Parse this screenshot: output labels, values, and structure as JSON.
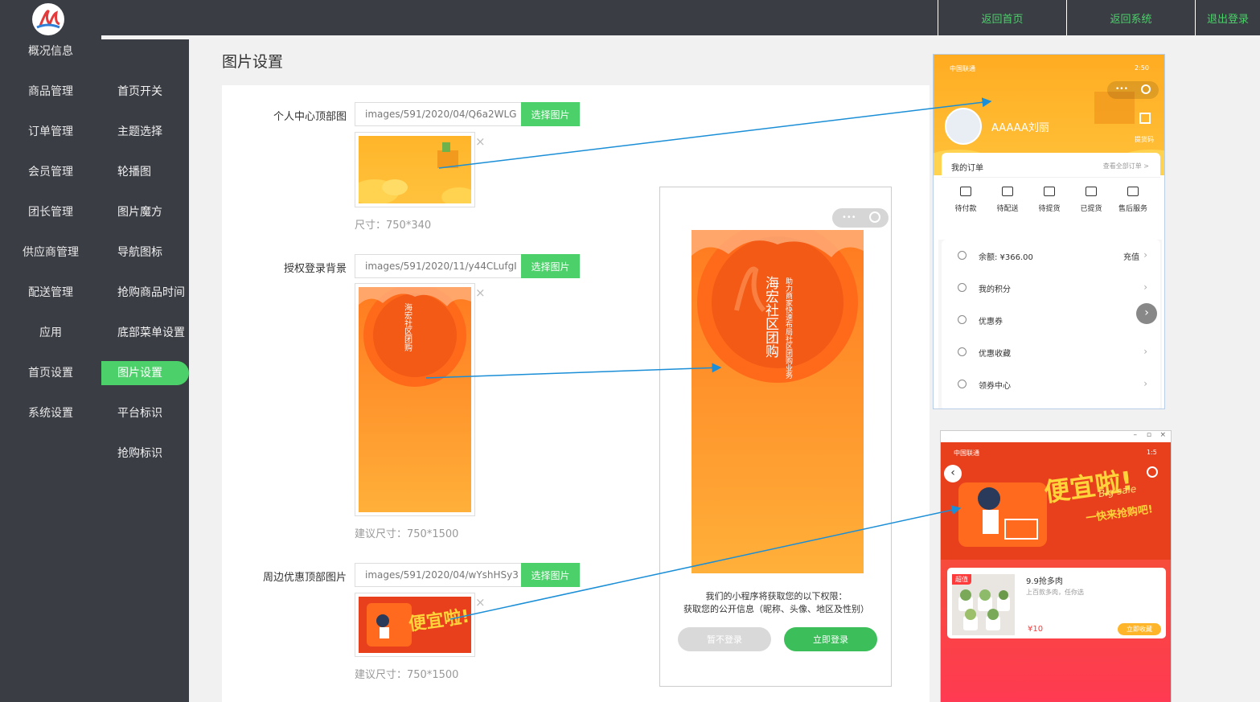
{
  "header": {
    "links": [
      "返回首页",
      "返回系统",
      "退出登录"
    ],
    "accent": "#4cd06a"
  },
  "sidebar_primary": {
    "items": [
      "概况信息",
      "商品管理",
      "订单管理",
      "会员管理",
      "团长管理",
      "供应商管理",
      "配送管理",
      "应用",
      "首页设置",
      "系统设置"
    ]
  },
  "sidebar_secondary": {
    "items": [
      "首页开关",
      "主题选择",
      "轮播图",
      "图片魔方",
      "导航图标",
      "抢购商品时间",
      "底部菜单设置",
      "图片设置",
      "平台标识",
      "抢购标识"
    ],
    "active": "图片设置"
  },
  "page": {
    "title": "图片设置"
  },
  "form": {
    "button_label": "选择图片",
    "fields": [
      {
        "label": "个人中心顶部图",
        "path": "images/591/2020/04/Q6a2WLG",
        "hint": "尺寸：750*340"
      },
      {
        "label": "授权登录背景",
        "path": "images/591/2020/11/y44CLufgI",
        "hint": "建议尺寸：750*1500"
      },
      {
        "label": "周边优惠顶部图片",
        "path": "images/591/2020/04/wYshHSy3",
        "hint": "建议尺寸：750*1500"
      }
    ],
    "remove_glyph": "×"
  },
  "preview_profile": {
    "status_carrier": "中国联通",
    "status_time": "2:50",
    "username": "AAAAA刘丽",
    "qr_label": "提货码",
    "orders_title": "我的订单",
    "orders_all": "查看全部订单 >",
    "order_items": [
      "待付款",
      "待配送",
      "待提货",
      "已提货",
      "售后服务"
    ],
    "rows": [
      {
        "label": "余额: ¥366.00",
        "right": "充值"
      },
      {
        "label": "我的积分",
        "right": ""
      },
      {
        "label": "优惠券",
        "right": ""
      },
      {
        "label": "优惠收藏",
        "right": ""
      },
      {
        "label": "领券中心",
        "right": ""
      }
    ]
  },
  "preview_login": {
    "brand_title": "海宏社区团购",
    "brand_sub": "助力商家快速布局社区团购业务",
    "permission_line1": "我们的小程序将获取您的以下权限：",
    "permission_line2": "获取您的公开信息（昵称、头像、地区及性别）",
    "btn_skip": "暂不登录",
    "btn_login": "立即登录"
  },
  "preview_sale": {
    "status_carrier": "中国联通",
    "status_time": "1:5",
    "banner_title": "便宜啦!",
    "banner_sub": "Big sale",
    "banner_cta": "一快来抢购吧!",
    "card_badge": "超值",
    "card_title": "9.9抢多肉",
    "card_desc": "上百款多肉，任你选",
    "card_price": "¥10",
    "card_button": "立即收藏"
  }
}
